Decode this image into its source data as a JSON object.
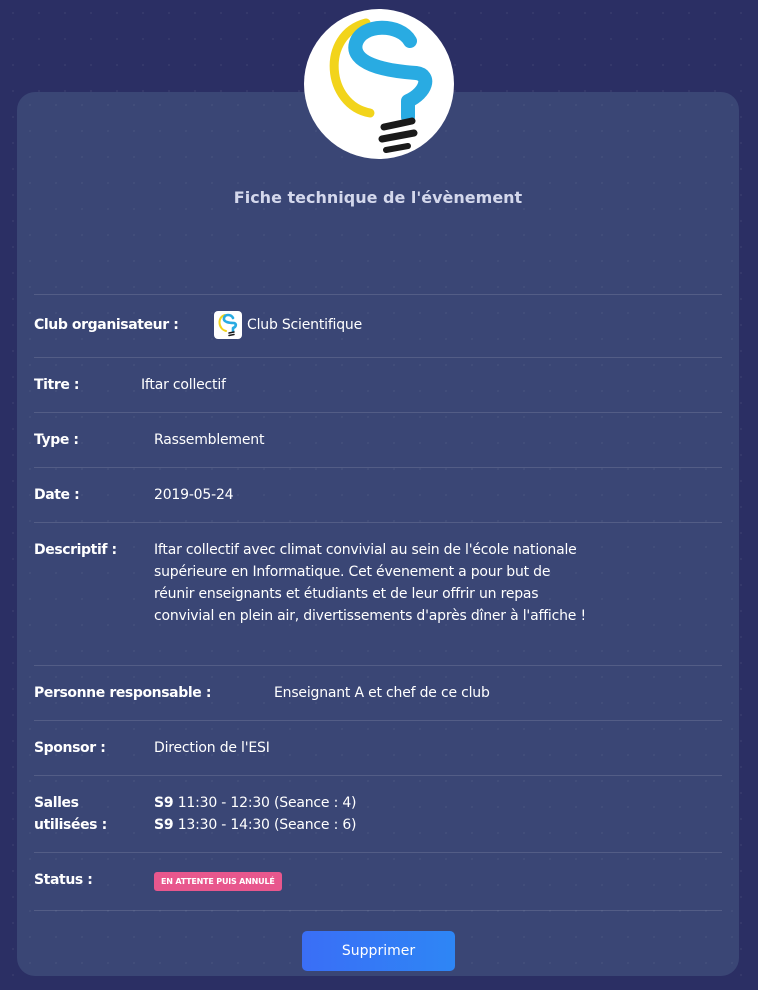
{
  "card": {
    "title": "Fiche technique de l'évènement"
  },
  "fields": {
    "club_label": "Club organisateur :",
    "club_value": "Club Scientifique",
    "title_label": "Titre :",
    "title_value": "Iftar collectif",
    "type_label": "Type :",
    "type_value": "Rassemblement",
    "date_label": "Date :",
    "date_value": "2019-05-24",
    "desc_label": "Descriptif :",
    "desc_value": "Iftar collectif avec climat convivial au sein de l'école nationale supérieure en Informatique. Cet évenement a pour but de réunir enseignants et étudiants et de leur offrir un repas convivial en plein air, divertissements d'après dîner à l'affiche !",
    "resp_label": "Personne responsable :",
    "resp_value": "Enseignant A et chef de ce club",
    "sponsor_label": "Sponsor :",
    "sponsor_value": "Direction de l'ESI",
    "salles_label_1": "Salles",
    "salles_label_2": "utilisées :",
    "status_label": "Status :",
    "status_value": "EN ATTENTE PUIS ANNULÉ"
  },
  "salles": [
    {
      "room": "S9",
      "time": "11:30 - 12:30 (Seance : 4)"
    },
    {
      "room": "S9",
      "time": "13:30 - 14:30 (Seance : 6)"
    }
  ],
  "actions": {
    "delete_label": "Supprimer"
  },
  "colors": {
    "background": "#2b2f64",
    "card": "#3a4675",
    "badge": "#e8578d",
    "button": "#3a6ef6",
    "logo_blue": "#29abe2",
    "logo_yellow": "#f2d41b"
  },
  "icons": {
    "logo": "lightbulb-s-logo",
    "club_logo": "club-scientifique-logo"
  }
}
